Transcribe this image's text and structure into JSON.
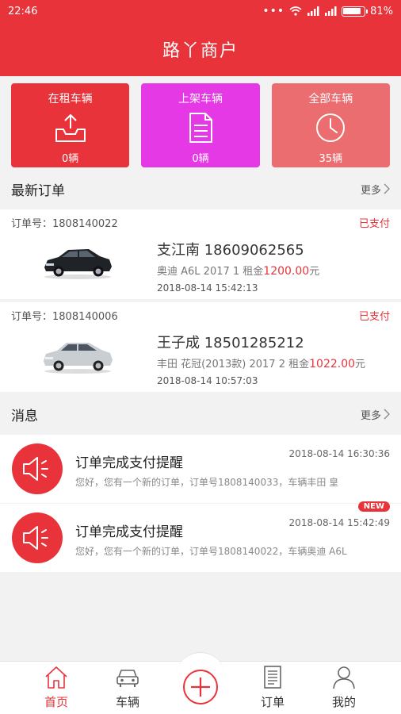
{
  "status_bar": {
    "time": "22:46",
    "battery": "81%"
  },
  "app": {
    "title": "路丫商户"
  },
  "cards": [
    {
      "label": "在租车辆",
      "count": "0辆",
      "color": "#e8333a",
      "icon": "upload-tray-icon"
    },
    {
      "label": "上架车辆",
      "count": "0辆",
      "color": "#e639e6",
      "icon": "document-icon"
    },
    {
      "label": "全部车辆",
      "count": "35辆",
      "color": "#ec6d6f",
      "icon": "clock-icon"
    }
  ],
  "orders_section": {
    "title": "最新订单",
    "more": "更多"
  },
  "orders": [
    {
      "order_no": "订单号：1808140022",
      "status": "已支付",
      "name": "支江南 18609062565",
      "desc_prefix": "奥迪 A6L 2017 1 租金",
      "price": "1200.00",
      "desc_suffix": "元",
      "time": "2018-08-14 15:42:13"
    },
    {
      "order_no": "订单号：1808140006",
      "status": "已支付",
      "name": "王子成 18501285212",
      "desc_prefix": "丰田 花冠(2013款) 2017 2 租金",
      "price": "1022.00",
      "desc_suffix": "元",
      "time": "2018-08-14 10:57:03"
    }
  ],
  "messages_section": {
    "title": "消息",
    "more": "更多"
  },
  "messages": [
    {
      "title": "订单完成支付提醒",
      "time": "2018-08-14 16:30:36",
      "body": "您好，您有一个新的订单，订单号1808140033，车辆丰田 皇",
      "is_new": false
    },
    {
      "title": "订单完成支付提醒",
      "time": "2018-08-14 15:42:49",
      "body": "您好，您有一个新的订单，订单号1808140022，车辆奥迪 A6L",
      "is_new": true,
      "badge": "NEW"
    }
  ],
  "tabbar": {
    "tabs": [
      {
        "label": "首页",
        "icon": "home-icon",
        "active": true
      },
      {
        "label": "车辆",
        "icon": "car-icon",
        "active": false
      },
      {
        "label": "",
        "icon": "add-icon",
        "active": false
      },
      {
        "label": "订单",
        "icon": "order-list-icon",
        "active": false
      },
      {
        "label": "我的",
        "icon": "profile-icon",
        "active": false
      }
    ]
  },
  "colors": {
    "primary": "#e8333a",
    "magenta": "#e639e6",
    "salmon": "#ec6d6f"
  }
}
